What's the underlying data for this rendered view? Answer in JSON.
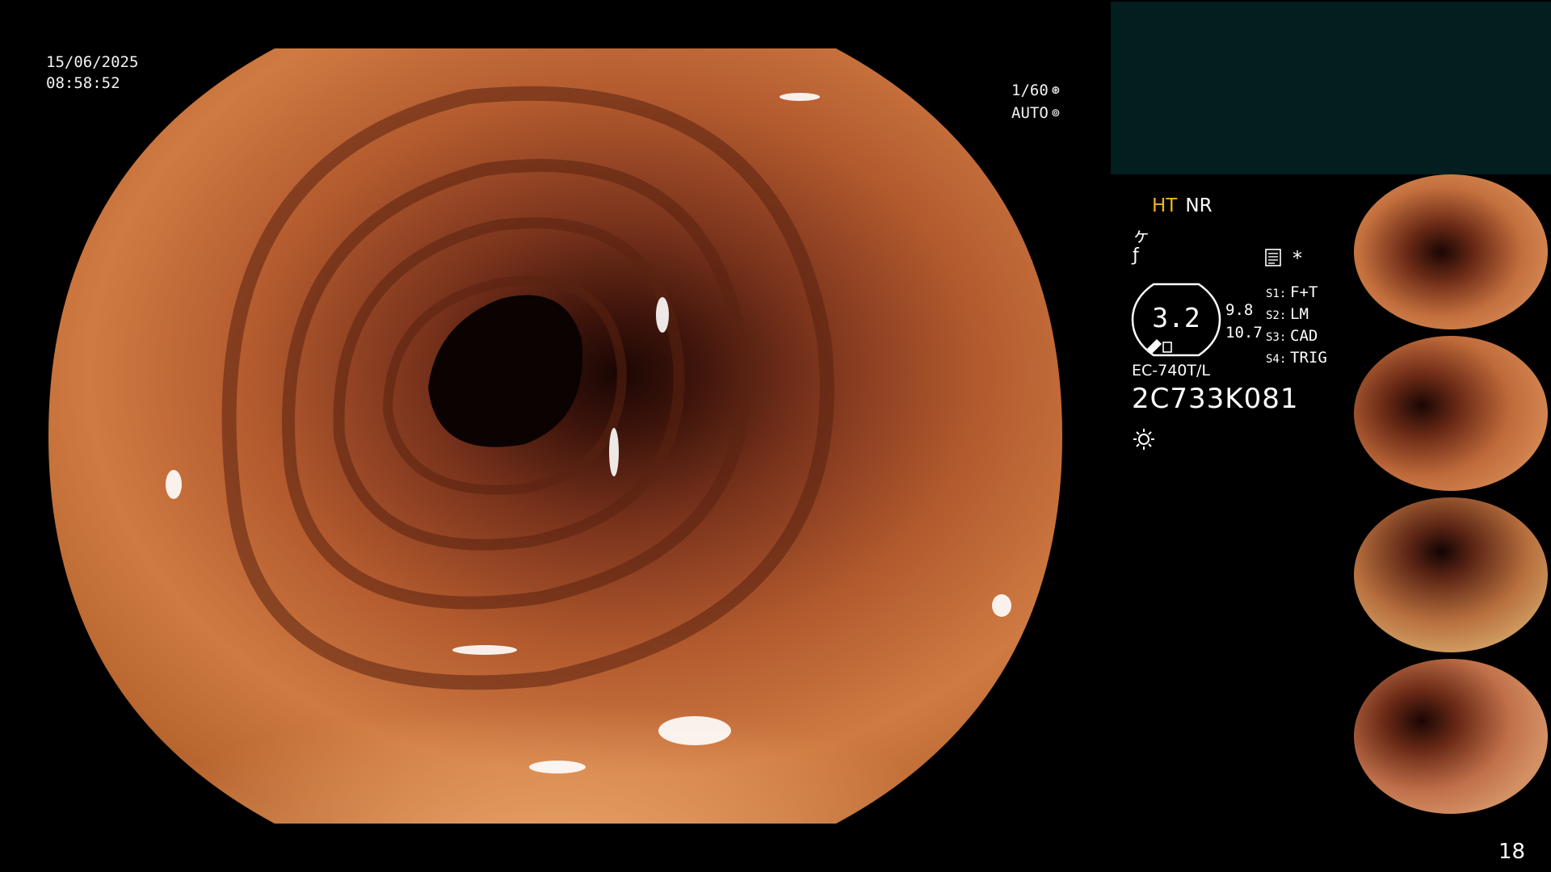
{
  "overlay": {
    "date": "15/06/2025",
    "time": "08:58:52",
    "shutter_speed": "1/60",
    "exposure_mode": "AUTO",
    "shutter_icon": "aperture-icon",
    "exposure_icon": "iris-icon"
  },
  "status": {
    "ht_label": "HT",
    "nr_label": "NR",
    "ht_color": "#f3b51b",
    "panel_color": "#031e1e"
  },
  "zoom": {
    "value": "3.2",
    "meta_top": "9.8",
    "meta_bottom": "10.7"
  },
  "switches": [
    {
      "key": "S1:",
      "value": "F+T"
    },
    {
      "key": "S2:",
      "value": "LM"
    },
    {
      "key": "S3:",
      "value": "CAD"
    },
    {
      "key": "S4:",
      "value": "TRIG"
    }
  ],
  "scope": {
    "model": "EC-740T/L",
    "serial": "2C733K081",
    "light_icon": "sun-icon"
  },
  "misc": {
    "star": "*",
    "page_number": "18"
  },
  "thumbnails": [
    {
      "label": "capture-1"
    },
    {
      "label": "capture-2"
    },
    {
      "label": "capture-3"
    },
    {
      "label": "capture-4"
    }
  ]
}
